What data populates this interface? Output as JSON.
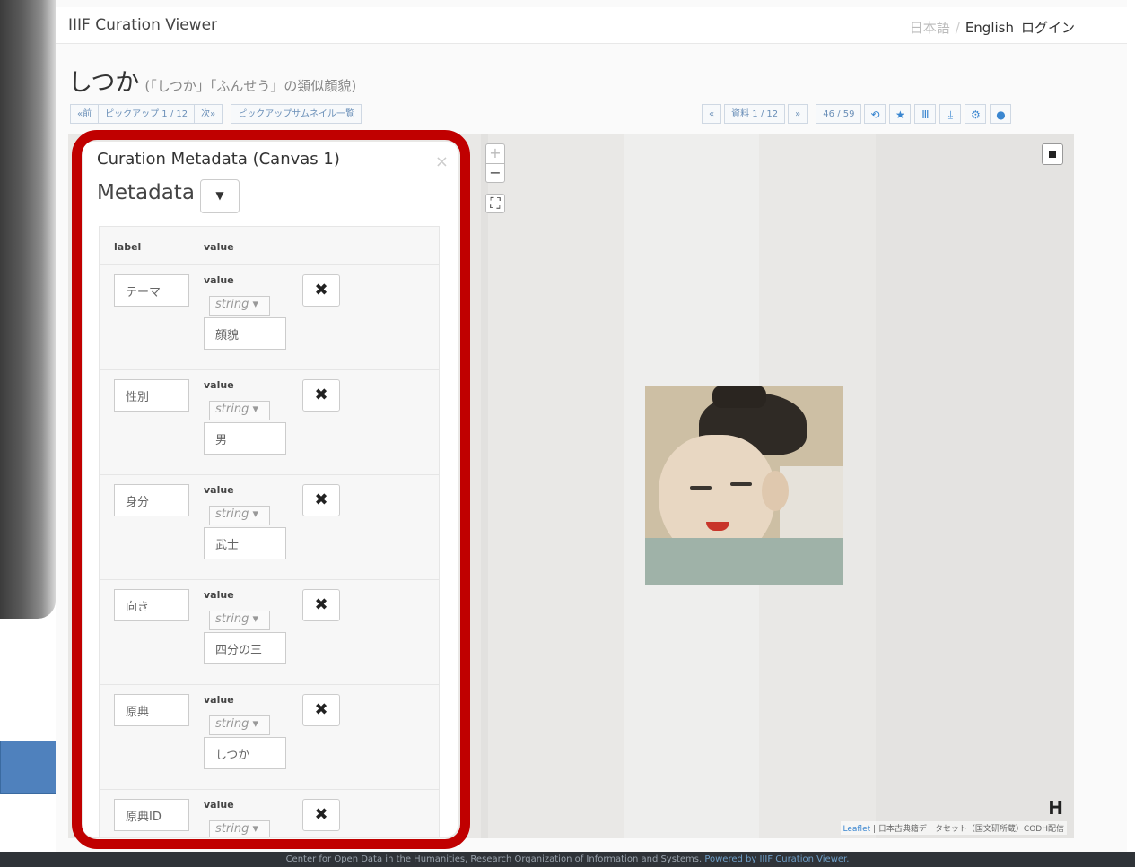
{
  "header": {
    "brand": "IIIF Curation Viewer",
    "lang_ja": "日本語",
    "lang_sep": "/",
    "lang_en": "English",
    "login": "ログイン"
  },
  "title": {
    "main": "しつか",
    "sub": "(「しつか」「ふんせう」の類似顔貌)"
  },
  "toolbar_left": [
    "«前",
    "ピックアップ 1 / 12",
    "次»",
    "ピックアップサムネイル一覧"
  ],
  "toolbar_right": {
    "prev": "«",
    "doc": "資料 1 / 12",
    "next": "»",
    "count": "46 / 59",
    "icons": [
      "share-icon",
      "star-icon",
      "metadata-icon",
      "download-icon",
      "settings-icon",
      "info-icon"
    ]
  },
  "viewer": {
    "zoom_in": "+",
    "zoom_out": "−",
    "leaflet": "Leaflet",
    "attribution": "| 日本古典籍データセット（国文研所蔵）CODH配信"
  },
  "panel": {
    "title": "Curation Metadata (Canvas 1)",
    "close": "×",
    "heading": "Metadata",
    "col_label": "label",
    "col_value": "value",
    "rows": [
      {
        "label": "テーマ",
        "vhead": "value",
        "type": "string ▾",
        "value": "顔貌"
      },
      {
        "label": "性別",
        "vhead": "value",
        "type": "string ▾",
        "value": "男"
      },
      {
        "label": "身分",
        "vhead": "value",
        "type": "string ▾",
        "value": "武士"
      },
      {
        "label": "向き",
        "vhead": "value",
        "type": "string ▾",
        "value": "四分の三"
      },
      {
        "label": "原典",
        "vhead": "value",
        "type": "string ▾",
        "value": "しつか"
      },
      {
        "label": "原典ID",
        "vhead": "value",
        "type": "string ▾",
        "value": ""
      }
    ]
  },
  "footer": {
    "text": "Center for Open Data in the Humanities, Research Organization of Information and Systems. ",
    "powered": "Powered by IIIF Curation Viewer."
  },
  "colors": {
    "highlight_frame": "#c00000",
    "accent_blue": "#4f81bd",
    "footer_bg": "#2f3338"
  }
}
